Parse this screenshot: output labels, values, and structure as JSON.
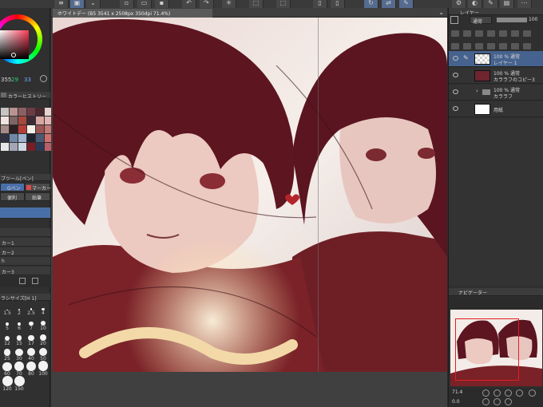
{
  "app": {
    "doc_tab_title": "ホワイトデー (B5 3541 x 2508px 350dpi 71.4%)"
  },
  "color": {
    "h_value": "355",
    "s_value": "29",
    "v_value": "33",
    "history_title": "カラーヒストリー",
    "history_swatches": [
      "#c9c4c4",
      "#b99391",
      "#8c5f63",
      "#6e3b44",
      "#4a2a2f",
      "#e9d2cf",
      "#f1e3e0",
      "#7e6666",
      "#a6483c",
      "#3d2a35",
      "#d7a7a1",
      "#e2b6b4",
      "#a58c89",
      "#2d2022",
      "#b73c38",
      "#f5efe8",
      "#9c5553",
      "#c27978",
      "#313244",
      "#6f88a6",
      "#9fb3cf",
      "#1f2230",
      "#4b5a72",
      "#d06e6e",
      "#e6e6ea",
      "#a3a7b5",
      "#cfd6e3",
      "#7a1d25",
      "#2a3a55",
      "#b85e69"
    ]
  },
  "tools": {
    "subtool_title": "ブツール[ペン]",
    "sub_a": "Gペン",
    "sub_b": "マーカー",
    "sub_c": "便利",
    "sub_d": "鉛筆",
    "items": [
      "カー1",
      "カー2",
      "h",
      "カー3"
    ]
  },
  "brush": {
    "title": "ラシサイズ[H 1]",
    "sizes": [
      "1.5",
      "2",
      "2.5",
      "4",
      "5",
      "6",
      "7",
      "10",
      "12",
      "15",
      "17",
      "20",
      "25",
      "30",
      "40",
      "50",
      "60",
      "70",
      "80",
      "100",
      "120",
      "150"
    ]
  },
  "layers": {
    "panel_title": "レイヤー",
    "blend_mode": "通常",
    "opacity": "100",
    "rows": [
      {
        "line1": "100 % 通常",
        "line2": "レイヤー 1"
      },
      {
        "line1": "100 % 通常",
        "line2": "カララフのコピー3"
      },
      {
        "line1": "100 % 通常",
        "line2": "カララフ"
      },
      {
        "line1": "",
        "line2": "用紙"
      }
    ]
  },
  "navigator": {
    "title": "ナビゲーター",
    "zoom": "71.4",
    "rotation": "0.0"
  },
  "colors": {
    "accent": "#46628e",
    "panel_bg": "#303030",
    "canvas_bg": "#404040"
  }
}
